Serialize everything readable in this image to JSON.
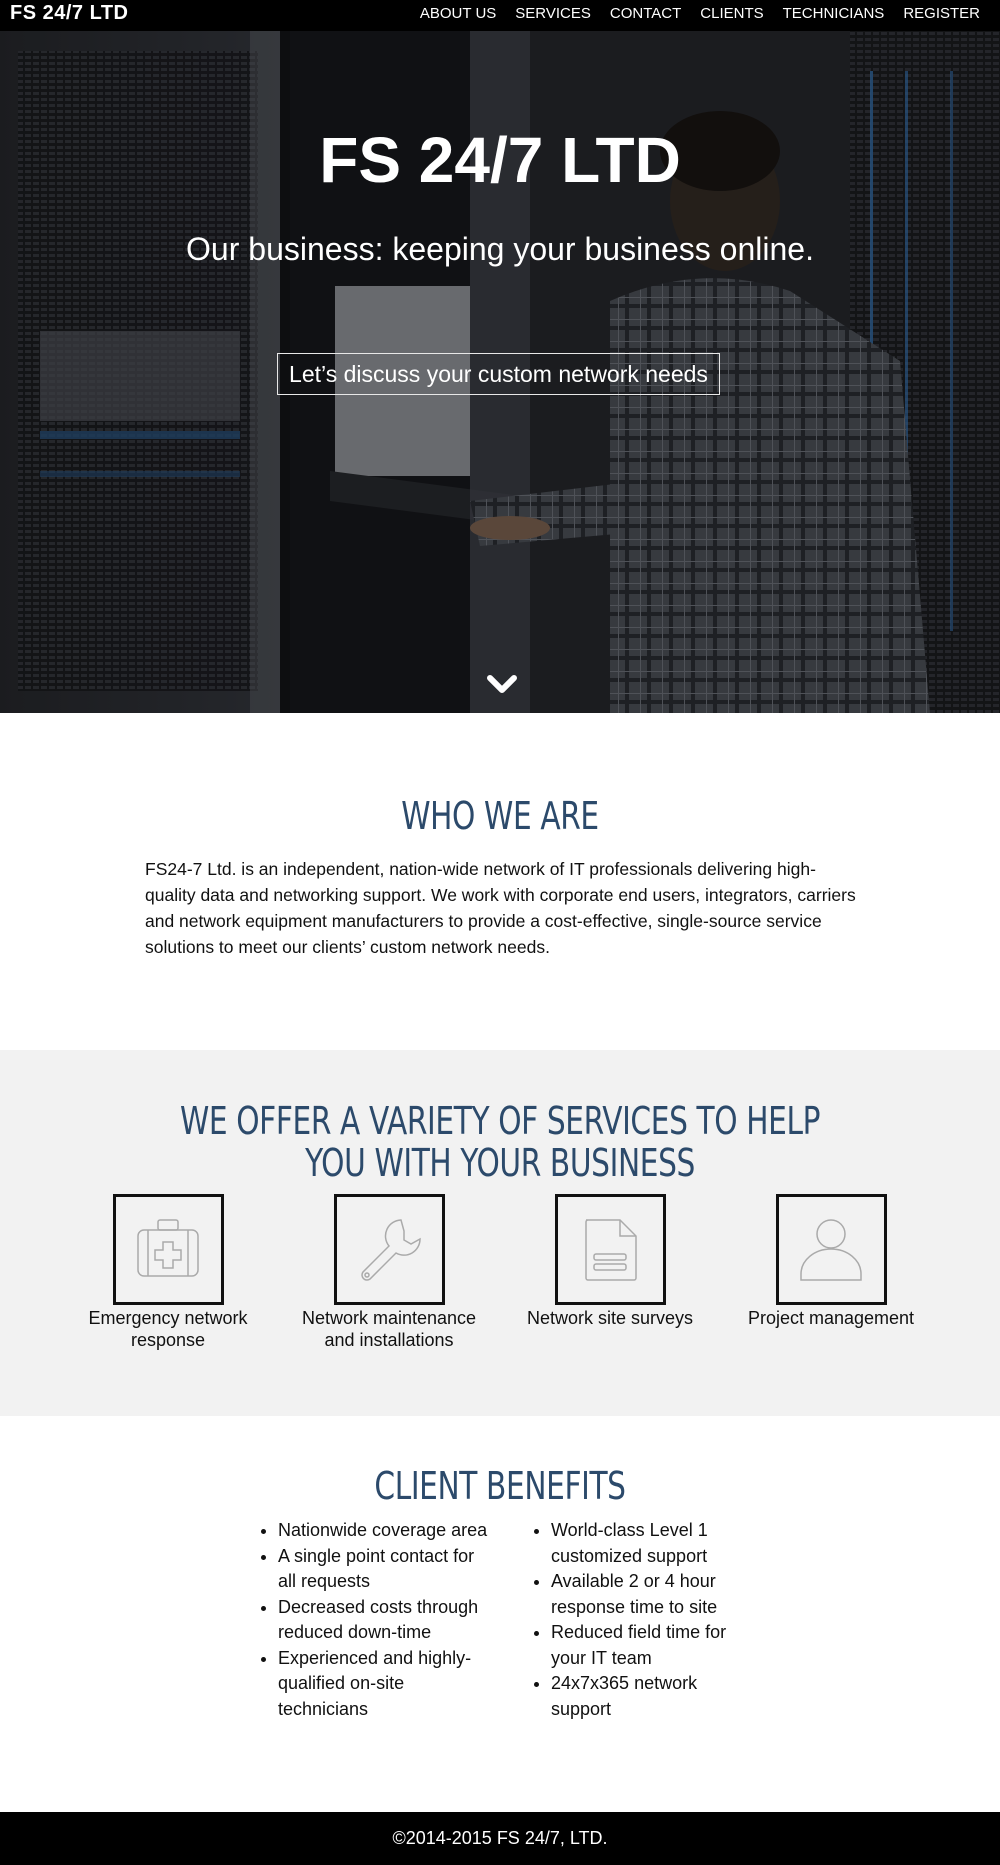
{
  "nav": {
    "brand": "FS  24/7 LTD",
    "items": [
      "ABOUT US",
      "SERVICES",
      "CONTACT",
      "CLIENTS",
      "TECHNICIANS",
      "REGISTER"
    ]
  },
  "hero": {
    "title": "FS 24/7 LTD",
    "subtitle": "Our business: keeping your business online.",
    "cta": "Let’s discuss your custom network needs",
    "scroll_icon": "chevron-down-icon"
  },
  "who": {
    "title": "WHO WE ARE",
    "text": "FS24-7 Ltd. is an independent, nation-wide network of IT professionals delivering high-quality data and networking support. We work with corporate end users, integrators, carriers and network equipment manufacturers to provide a cost-effective, single-source service solutions to meet our clients’ custom network needs."
  },
  "services": {
    "title_line1": "WE OFFER A VARIETY OF SERVICES TO HELP",
    "title_line2": "YOU WITH YOUR BUSINESS",
    "items": [
      {
        "icon": "first-aid-kit-icon",
        "label_line1": "Emergency network",
        "label_line2": "response"
      },
      {
        "icon": "wrench-icon",
        "label_line1": "Network maintenance",
        "label_line2": "and installations"
      },
      {
        "icon": "document-icon",
        "label_line1": "Network site surveys",
        "label_line2": ""
      },
      {
        "icon": "user-icon",
        "label_line1": "Project management",
        "label_line2": ""
      }
    ]
  },
  "benefits": {
    "title": "CLIENT BENEFITS",
    "left": [
      "Nationwide coverage area",
      "A single point contact for all requests",
      "Decreased costs through reduced down-time",
      "Experienced and highly-qualified on-site technicians"
    ],
    "right": [
      "World-class Level 1 customized support",
      "Available 2 or 4 hour response time to site",
      "Reduced field time for your IT team",
      "24x7x365 network support"
    ]
  },
  "footer": {
    "copyright": "©2014-2015 FS 24/7, LTD."
  },
  "colors": {
    "heading": "#2c4a6b",
    "nav_bg": "#000000",
    "services_bg": "#f2f2f2",
    "footer_bg": "#000000"
  }
}
